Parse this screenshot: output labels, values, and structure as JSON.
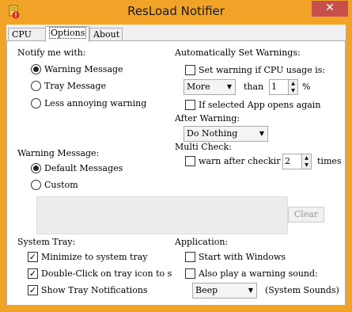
{
  "window": {
    "title": "ResLoad Notifier",
    "close_symbol": "✕"
  },
  "tabs": [
    {
      "label": "CPU"
    },
    {
      "label": "Options",
      "active": true
    },
    {
      "label": "About"
    }
  ],
  "notify": {
    "heading": "Notify me with:",
    "options": [
      "Warning Message",
      "Tray Message",
      "Less annoying warning"
    ],
    "selected": "Warning Message"
  },
  "warning_message": {
    "heading": "Warning Message:",
    "options": [
      "Default Messages",
      "Custom"
    ],
    "selected": "Default Messages",
    "clear_label": "Clear"
  },
  "auto_set": {
    "heading": "Automatically Set Warnings:",
    "cpu_usage_label": "Set warning if CPU usage is:",
    "cpu_usage_checked": false,
    "comparison_value": "More",
    "than_label": "than",
    "threshold_value": "1",
    "percent_label": "%",
    "app_opens_label": "If selected App opens again",
    "app_opens_checked": false
  },
  "after_warning": {
    "heading": "After Warning:",
    "value": "Do Nothing"
  },
  "multi_check": {
    "heading": "Multi Check:",
    "label": "warn after checkir",
    "checked": false,
    "count_value": "2",
    "times_label": "times"
  },
  "system_tray": {
    "heading": "System Tray:",
    "items": [
      {
        "label": "Minimize to system tray",
        "checked": true
      },
      {
        "label": "Double-Click on tray icon to s",
        "checked": true
      },
      {
        "label": "Show Tray Notifications",
        "checked": true
      }
    ]
  },
  "application": {
    "heading": "Application:",
    "start_label": "Start with Windows",
    "start_checked": false,
    "sound_label": "Also play a warning sound:",
    "sound_checked": false,
    "sound_value": "Beep",
    "sound_source": "(System Sounds)"
  },
  "colors": {
    "titlebar": "#f0a326",
    "close": "#c7504a",
    "panel": "#ffffff"
  }
}
